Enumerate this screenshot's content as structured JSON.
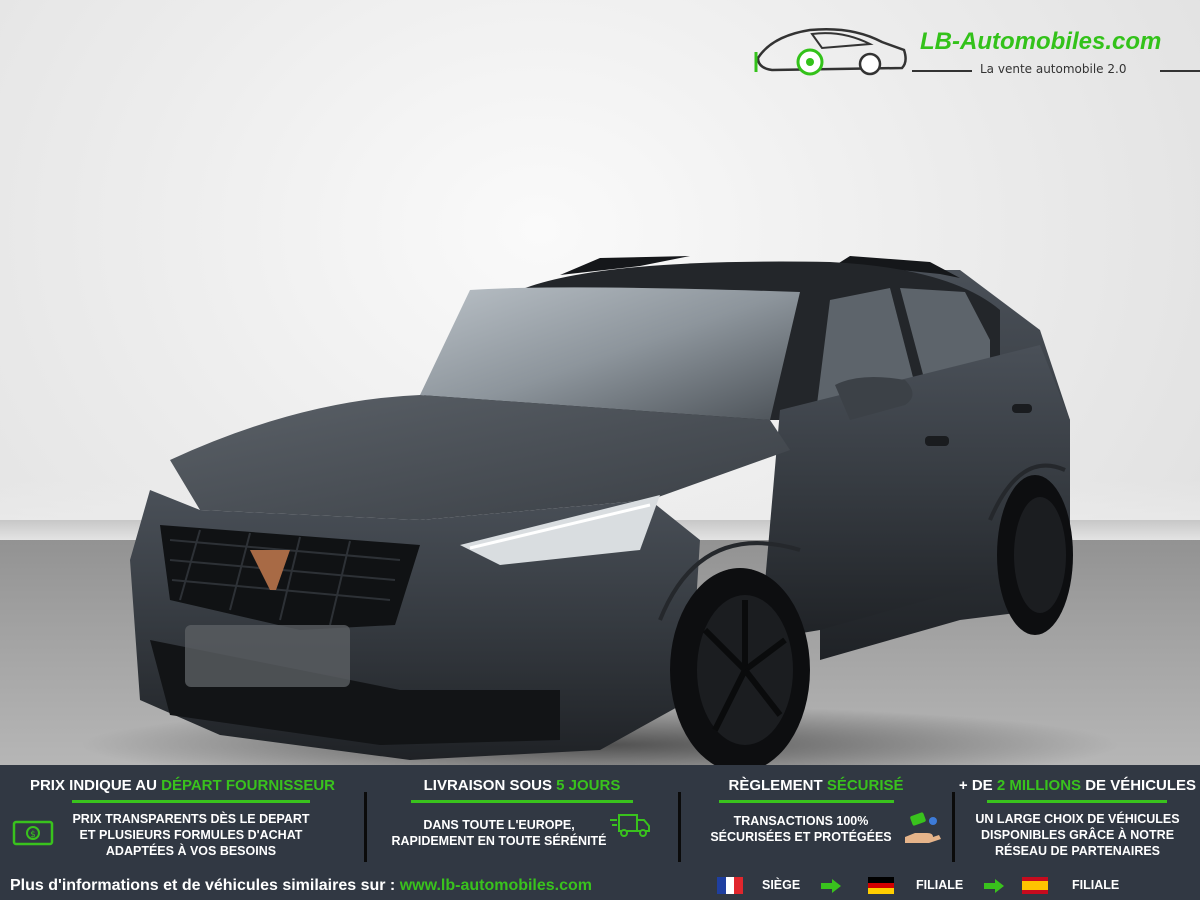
{
  "logo": {
    "name": "LB-Automobiles.com",
    "tagline": "La vente automobile 2.0",
    "accent": "#33c21a"
  },
  "features": [
    {
      "title_pre": "PRIX INDIQUE AU ",
      "title_hl": "DÉPART FOURNISSEUR",
      "title_post": "",
      "line1": "PRIX TRANSPARENTS DÈS LE DEPART",
      "line2": "ET PLUSIEURS FORMULES D'ACHAT",
      "line3": "ADAPTÉES À VOS BESOINS",
      "icon": "money-icon"
    },
    {
      "title_pre": "LIVRAISON SOUS ",
      "title_hl": "5 JOURS",
      "title_post": "",
      "line1": "DANS TOUTE L'EUROPE,",
      "line2": "RAPIDEMENT EN TOUTE SÉRÉNITÉ",
      "icon": "delivery-truck-icon"
    },
    {
      "title_pre": "RÈGLEMENT ",
      "title_hl": "SÉCURISÉ",
      "title_post": "",
      "line1": "TRANSACTIONS 100%",
      "line2": "SÉCURISÉES ET PROTÉGÉES",
      "icon": "payment-hand-icon"
    },
    {
      "title_pre": "+ DE ",
      "title_hl": "2 MILLIONS",
      "title_post": " DE VÉHICULES",
      "line1": "UN LARGE CHOIX DE VÉHICULES",
      "line2": "DISPONIBLES GRÂCE À NOTRE",
      "line3": "RÉSEAU DE PARTENAIRES"
    }
  ],
  "footer": {
    "text": "Plus d'informations et de véhicules similaires sur : ",
    "url": "www.lb-automobiles.com",
    "locations": [
      {
        "flag": "france-flag-icon",
        "label": "SIÈGE"
      },
      {
        "flag": "germany-flag-icon",
        "label": "FILIALE"
      },
      {
        "flag": "spain-flag-icon",
        "label": "FILIALE"
      }
    ]
  },
  "colors": {
    "band": "#313843",
    "accent": "#39c21d",
    "car_body": "#3a3f45"
  }
}
